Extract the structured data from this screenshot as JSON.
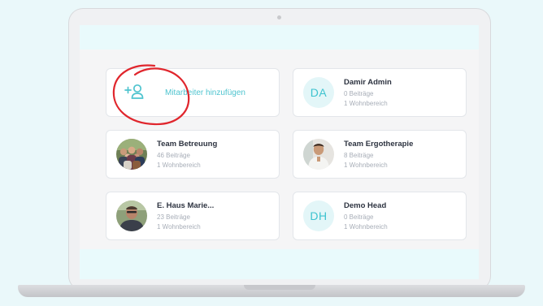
{
  "add_employee": {
    "label": "Mitarbeiter hinzufügen",
    "icon": "add-user-icon",
    "accent_color": "#4fc4cf",
    "highlight_color": "#e0262d"
  },
  "teams": [
    {
      "initials": "",
      "name": "Team Betreuung",
      "posts": "46 Beiträge",
      "areas": "1 Wohnbereich",
      "avatar": "group-photo"
    },
    {
      "initials": "",
      "name": "Team Ergotherapie",
      "posts": "8 Beiträge",
      "areas": "1 Wohnbereich",
      "avatar": "person-photo"
    },
    {
      "initials": "",
      "name": "E. Haus Marie...",
      "posts": "23 Beiträge",
      "areas": "1 Wohnbereich",
      "avatar": "person-photo"
    }
  ],
  "admins": [
    {
      "initials": "DA",
      "name": "Damir Admin",
      "posts": "0 Beiträge",
      "areas": "1 Wohnbereich"
    },
    {
      "initials": "DH",
      "name": "Demo Head",
      "posts": "0 Beiträge",
      "areas": "1 Wohnbereich"
    }
  ]
}
